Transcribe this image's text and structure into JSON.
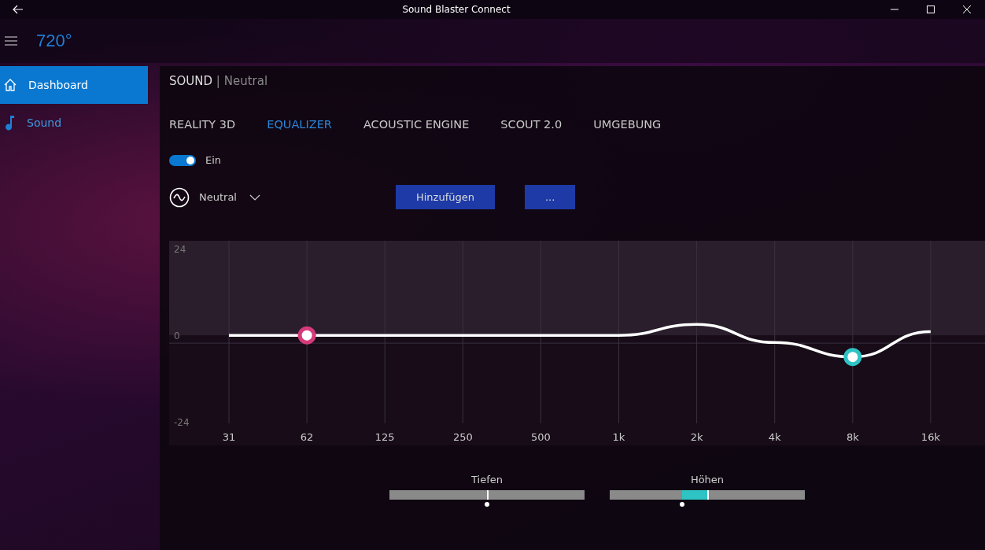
{
  "window": {
    "title": "Sound Blaster Connect"
  },
  "header": {
    "logo": "720°"
  },
  "sidebar": {
    "items": [
      {
        "label": "Dashboard",
        "kind": "home",
        "selected": true
      },
      {
        "label": "Sound",
        "kind": "note",
        "selected": false
      }
    ]
  },
  "breadcrumb": {
    "section": "SOUND",
    "separator": "|",
    "profile": "Neutral"
  },
  "tabs": [
    {
      "label": "REALITY 3D",
      "selected": false
    },
    {
      "label": "EQUALIZER",
      "selected": true
    },
    {
      "label": "ACOUSTIC ENGINE",
      "selected": false
    },
    {
      "label": "SCOUT 2.0",
      "selected": false
    },
    {
      "label": "UMGEBUNG",
      "selected": false
    }
  ],
  "toggle": {
    "label": "Ein",
    "on": true
  },
  "preset": {
    "value": "Neutral"
  },
  "buttons": [
    "Hinzufügen",
    "..."
  ],
  "equalizer": {
    "chart_data": {
      "type": "line",
      "categories": [
        "31",
        "62",
        "125",
        "250",
        "500",
        "1k",
        "2k",
        "4k",
        "8k",
        "16k"
      ],
      "yticks": [
        24,
        0,
        -24
      ],
      "ylim": [
        -24.4,
        26.2
      ],
      "grid": true,
      "series": [
        {
          "color": "#ffffff",
          "values": [
            0,
            0,
            0,
            0,
            0,
            0,
            3,
            -2,
            -6,
            1
          ]
        }
      ]
    }
  },
  "sliders": [
    {
      "label": "Tiefen",
      "level": 0.5,
      "color": "#d63a7a"
    },
    {
      "label": "Höhen",
      "level": 0.37,
      "color": "#2ec4c4"
    }
  ]
}
